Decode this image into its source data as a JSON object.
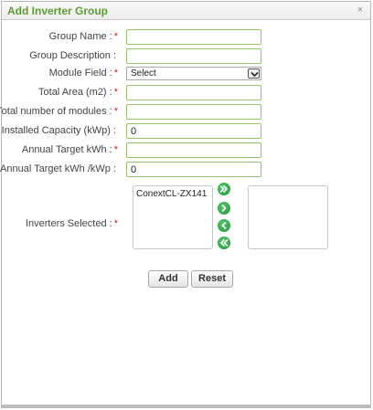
{
  "dialog": {
    "title": "Add Inverter Group",
    "close_label": "×"
  },
  "form": {
    "required_mark": "*",
    "group_name": {
      "label": "Group Name :",
      "required": true,
      "value": ""
    },
    "group_description": {
      "label": "Group Description :",
      "required": false,
      "value": ""
    },
    "module_field": {
      "label": "Module Field :",
      "required": true,
      "selected": "Select"
    },
    "total_area": {
      "label": "Total Area (m2) :",
      "required": true,
      "value": ""
    },
    "total_modules": {
      "label": "Total number of modules :",
      "required": true,
      "value": ""
    },
    "installed_capacity": {
      "label": "Installed Capacity (kWp) :",
      "required": false,
      "value": "0"
    },
    "annual_target_kwh": {
      "label": "Annual Target kWh :",
      "required": true,
      "value": ""
    },
    "annual_target_kwh_kwp": {
      "label": "Annual Target kWh /kWp :",
      "required": false,
      "value": "0"
    },
    "inverters_selected": {
      "label": "Inverters Selected :",
      "required": true,
      "available": [
        "ConextCL-ZX141"
      ],
      "selected": []
    }
  },
  "move_buttons": {
    "move_all_right": "move-all-right-icon",
    "move_right": "move-right-icon",
    "move_left": "move-left-icon",
    "move_all_left": "move-all-left-icon"
  },
  "buttons": {
    "add": "Add",
    "reset": "Reset"
  },
  "colors": {
    "title": "#5a9e2f",
    "field_border": "#97c36b",
    "required": "#d42020",
    "move_button": "#22943a"
  }
}
